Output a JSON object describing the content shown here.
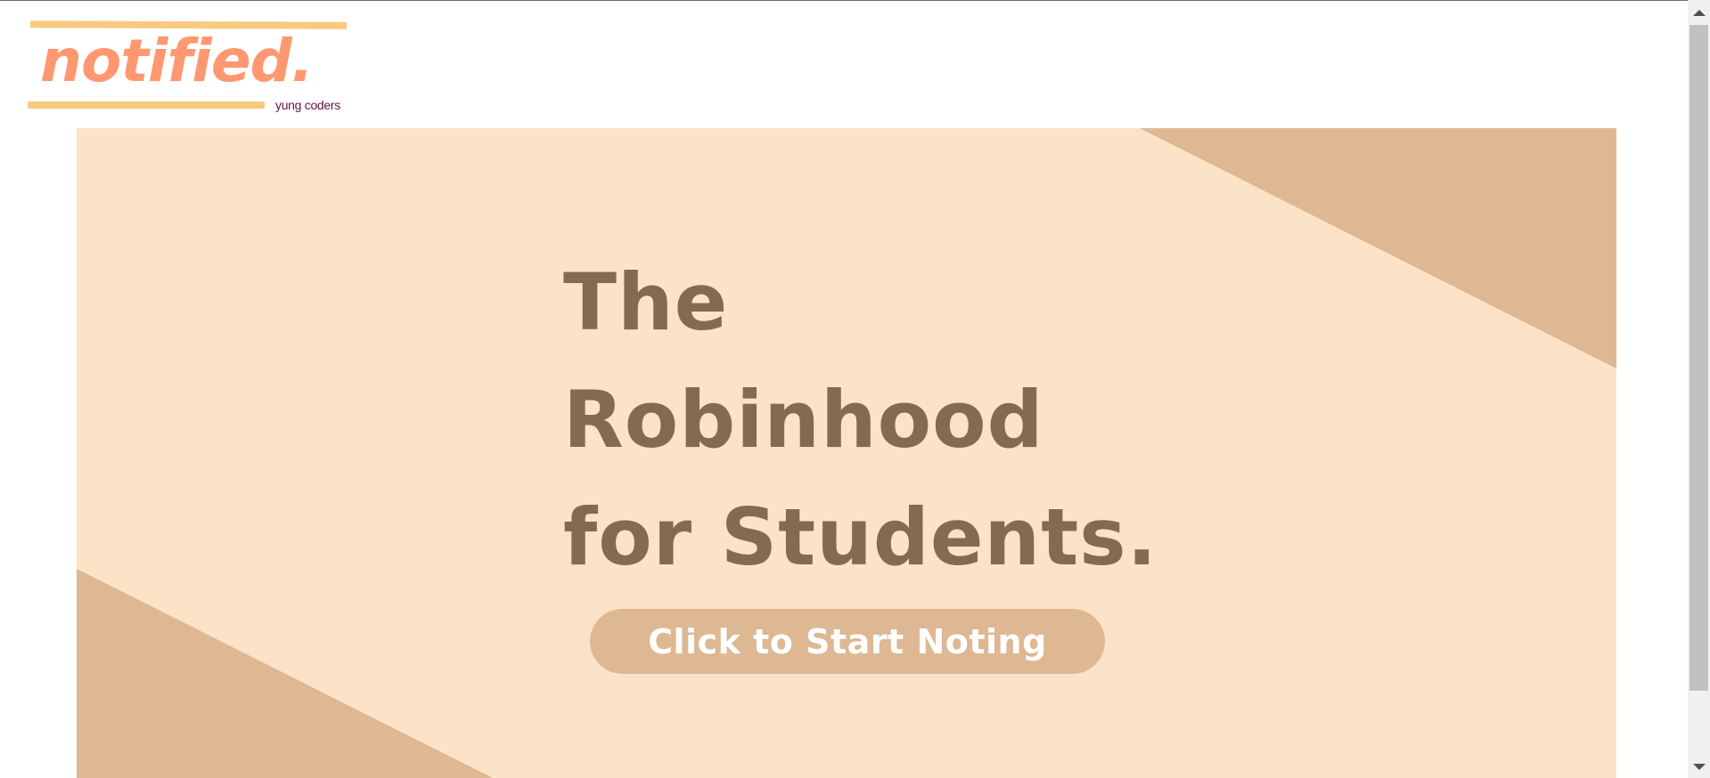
{
  "logo": {
    "wordmark": "notified.",
    "tagline": "yung coders",
    "colors": {
      "wordmark": "#ff9870",
      "underline": "#f9c97d",
      "tagline": "#6a1145"
    }
  },
  "hero": {
    "headline_lines": [
      "The",
      "Robinhood",
      "for Students."
    ],
    "cta_label": "Click to Start Noting",
    "colors": {
      "background": "#fce3c7",
      "accent": "#ddb893",
      "headline": "#856a51",
      "cta_text": "#ffffff"
    }
  },
  "scrollbar": {
    "up_icon": "scroll-up-arrow-icon",
    "down_icon": "scroll-down-arrow-icon"
  }
}
